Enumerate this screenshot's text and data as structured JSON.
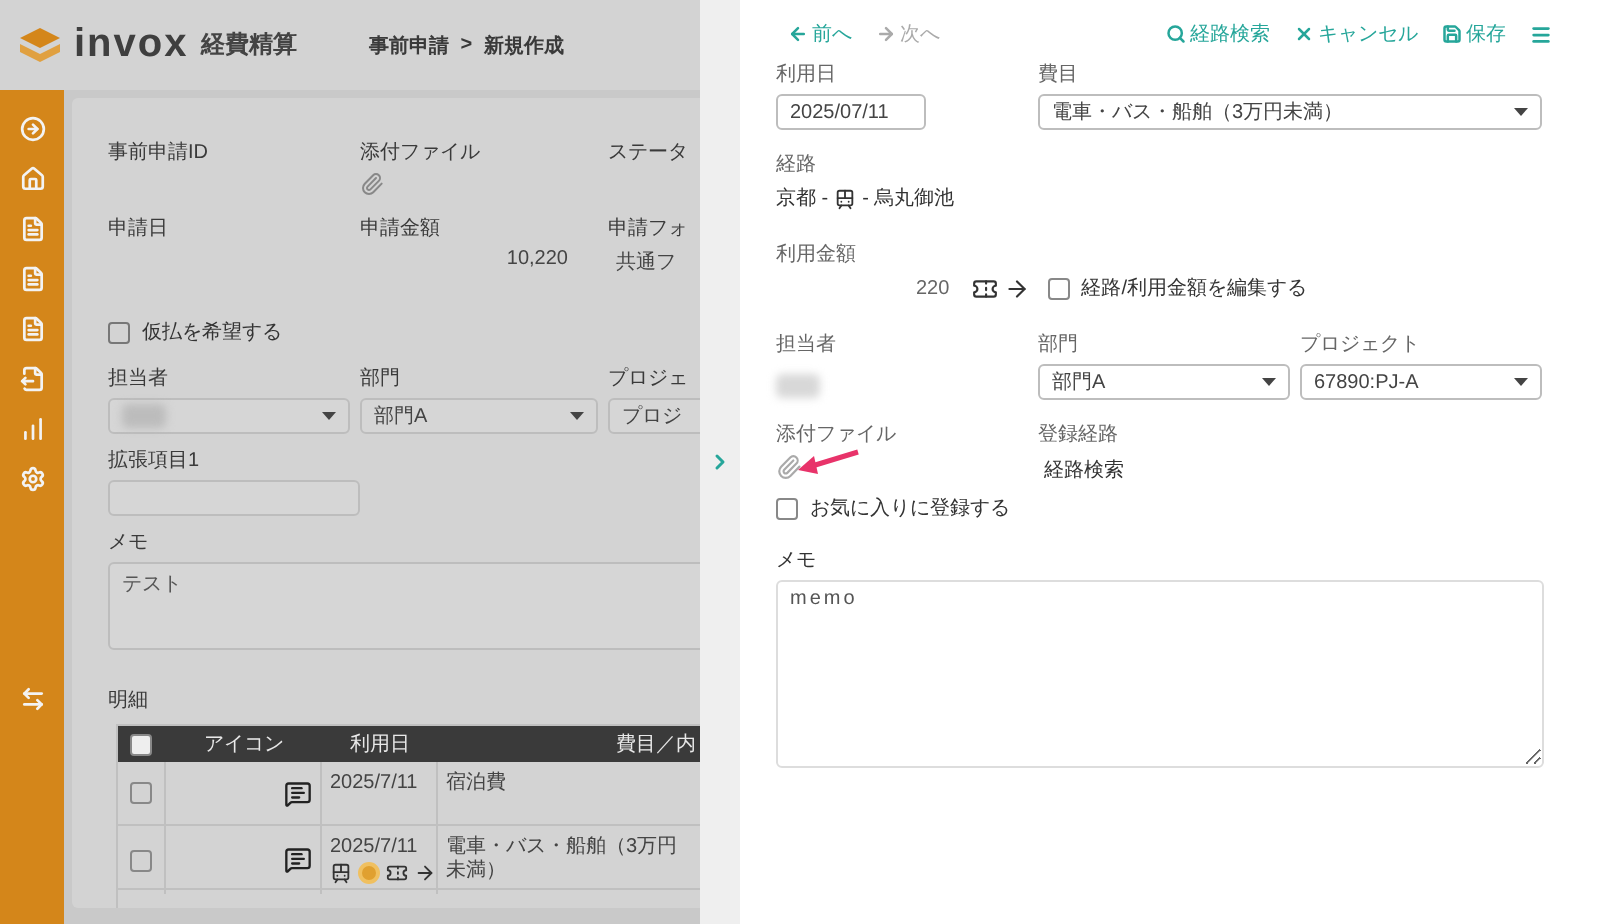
{
  "header": {
    "logo": "invox",
    "product": "経費精算",
    "breadcrumb": [
      {
        "label": "事前申請"
      },
      {
        "label": "新規作成"
      }
    ],
    "breadcrumb_separator": ">"
  },
  "request": {
    "info_rows": [
      [
        {
          "label": "事前申請ID",
          "kind": "text"
        },
        {
          "label": "添付ファイル",
          "kind": "attachment"
        },
        {
          "label": "ステータ",
          "kind": "text"
        }
      ],
      [
        {
          "label": "申請日",
          "kind": "text"
        },
        {
          "label": "申請金額",
          "kind": "amount",
          "value": "10,220"
        },
        {
          "label": "申請フォ",
          "kind": "text",
          "value": "共通フ"
        }
      ]
    ],
    "advance_payment": {
      "label": "仮払を希望する",
      "checked": false
    },
    "selects": [
      {
        "label": "担当者",
        "blurred": true
      },
      {
        "label": "部門",
        "blurred": false,
        "value": "部門A"
      },
      {
        "label": "プロジェ",
        "blurred": false,
        "value": "プロジ"
      }
    ],
    "extension": {
      "label": "拡張項目1"
    },
    "memo": {
      "label": "メモ",
      "value": "テスト"
    },
    "details": {
      "title": "明細",
      "header_checked": false,
      "columns": [
        {
          "label": "アイコン"
        },
        {
          "label": "利用日"
        },
        {
          "label": "費目／内"
        }
      ],
      "rows": [
        {
          "checked": false,
          "date": "2025/7/11",
          "category": "宿泊費",
          "route": false
        },
        {
          "checked": false,
          "date": "2025/7/11",
          "category": "電車・バス・船舶（3万円未満）",
          "route": true
        }
      ]
    }
  },
  "editor": {
    "nav": [
      {
        "kind": "prev",
        "label": "前へ",
        "disabled": false
      },
      {
        "kind": "next",
        "label": "次へ",
        "disabled": true
      }
    ],
    "actions": [
      {
        "kind": "search",
        "label": "経路検索"
      },
      {
        "kind": "cancel",
        "label": "キャンセル"
      },
      {
        "kind": "save",
        "label": "保存"
      },
      {
        "kind": "menu"
      }
    ],
    "date": {
      "label": "利用日",
      "value": "2025/07/11"
    },
    "category": {
      "label": "費目",
      "value": "電車・バス・船舶（3万円未満）"
    },
    "route": {
      "label": "経路",
      "from": "京都 -",
      "to": "- 烏丸御池"
    },
    "amount": {
      "label": "利用金額",
      "value": "220",
      "edit": {
        "label": "経路/利用金額を編集する",
        "checked": false
      }
    },
    "assignee": {
      "label": "担当者",
      "blurred": true
    },
    "department": {
      "label": "部門",
      "value": "部門A"
    },
    "project": {
      "label": "プロジェクト",
      "value": "67890:PJ-A"
    },
    "attachment": {
      "label": "添付ファイル"
    },
    "registered_route": {
      "label": "登録経路",
      "value": "経路検索"
    },
    "favorite": {
      "label": "お気に入りに登録する",
      "checked": false
    },
    "memo": {
      "label": "メモ",
      "value": "memo"
    }
  },
  "annotations": [
    {
      "kind": "arrow"
    }
  ]
}
